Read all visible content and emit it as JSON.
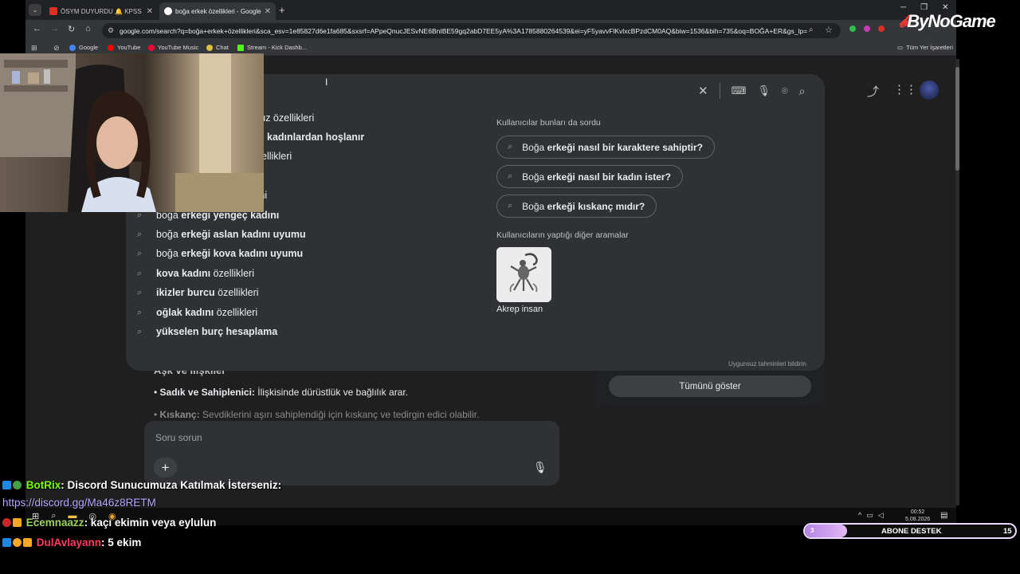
{
  "tabs": [
    {
      "title": "ÖSYM DUYURDU 🔔 KPSS Orta",
      "fav_color": "#d93025"
    },
    {
      "title": "boğa erkek özellikleri - Google",
      "fav_color": "#ffffff"
    }
  ],
  "toolbar": {
    "url": "google.com/search?q=boğa+erkek+özellikleri&sca_esv=1e85827d6e1fa685&sxsrf=APpeQnucJESvNE6BnIBE59gq2abD7EE5yA%3A1785880264539&ei=yF5yavvFlKvlxcBPzdCM0AQ&biw=1536&bih=735&oq=BOĞA+ER&gs_lp="
  },
  "bookmarks": {
    "items": [
      {
        "label": "Google",
        "color": "#4285f4"
      },
      {
        "label": "YouTube",
        "color": "#ff0000"
      },
      {
        "label": "YouTube Music",
        "color": "#ff0033"
      },
      {
        "label": "Chat",
        "color": "#e0c040"
      },
      {
        "label": "Stream - Kick Dashb...",
        "color": "#53fc18"
      }
    ],
    "all_bookmarks": "Tüm Yer İşaretleri"
  },
  "suggestions": [
    {
      "plain": "",
      "bold": "",
      "tail": "suz özellikleri",
      "tail_bold": false,
      "partial": true
    },
    {
      "plain": "",
      "bold": "kadınlardan hoşlanır",
      "tail": "",
      "partial": true
    },
    {
      "plain": "",
      "bold": "",
      "tail": "ellikleri",
      "partial": true
    },
    {
      "plain": "",
      "bold": "",
      "tail": "ıni",
      "partial": true
    },
    {
      "plain": "boğa ",
      "bold": "erkeği yengeç kadını",
      "tail": ""
    },
    {
      "plain": "boğa ",
      "bold": "erkeği aslan kadını uyumu",
      "tail": ""
    },
    {
      "plain": "boğa ",
      "bold": "erkeği kova kadını uyumu",
      "tail": ""
    },
    {
      "plain": "",
      "bold": "kova kadını",
      "tail": " özellikleri"
    },
    {
      "plain": "",
      "bold": "ikizler burcu",
      "tail": " özellikleri"
    },
    {
      "plain": "",
      "bold": "oğlak kadını",
      "tail": " özellikleri"
    },
    {
      "plain": "",
      "bold": "yükselen burç hesaplama",
      "tail": ""
    }
  ],
  "people_also_ask": {
    "title": "Kullanıcılar bunları da sordu",
    "items": [
      {
        "plain": "Boğa ",
        "bold": "erkeği nasıl bir karaktere sahiptir?"
      },
      {
        "plain": "Boğa ",
        "bold": "erkeği nasıl bir kadın ister?"
      },
      {
        "plain": "Boğa ",
        "bold": "erkeği kıskanç mıdır?"
      }
    ]
  },
  "other_searches": {
    "title": "Kullanıcıların yaptığı diğer aramalar",
    "item_label": "Akrep insan"
  },
  "report_link": "Uygunsuz tahminleri bildirin",
  "content": {
    "heading": "Aşk ve İlişkiler",
    "bullet1_bold": "Sadık ve Sahiplenici:",
    "bullet1_text": " İlişkisinde dürüstlük ve bağlılık arar.",
    "bullet2_bold": "Kıskanç:",
    "bullet2_text": " Sevdiklerini aşırı sahiplendiği için kıskanç ve tedirgin edici olabilir."
  },
  "show_all": "Tümünü göster",
  "ask": {
    "placeholder": "Soru sorun"
  },
  "taskbar": {
    "time": "00:52",
    "date": "5.08.2026"
  },
  "chat": [
    {
      "user": "BotRix",
      "user_color": "#7CFC00",
      "msg": ": Discord Sunucumuza Katılmak İsterseniz:"
    },
    {
      "user": "",
      "user_color": "#b9a6ff",
      "msg": "https://discord.gg/Ma46z8RETM"
    },
    {
      "user": "Ecemnaazz",
      "user_color": "#9ad05c",
      "msg": ": kaçı ekimin veya eylulun"
    },
    {
      "user": "DulAvlayann",
      "user_color": "#ff3b5c",
      "msg": ": 5 ekim"
    }
  ],
  "overlay": {
    "logo": "ByNoGame",
    "sub_label": "ABONE DESTEK",
    "sub_current": "3",
    "sub_goal": "15",
    "sub_progress": 0.2
  }
}
